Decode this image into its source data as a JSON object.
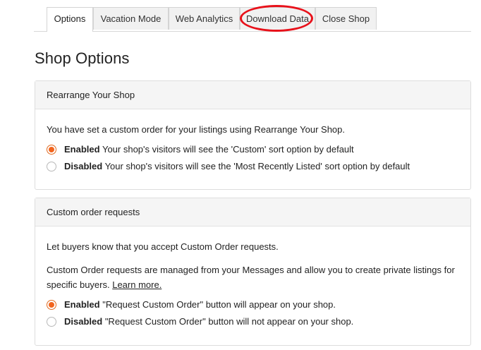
{
  "tabs": [
    {
      "label": "Options",
      "active": true
    },
    {
      "label": "Vacation Mode",
      "active": false
    },
    {
      "label": "Web Analytics",
      "active": false
    },
    {
      "label": "Download Data",
      "active": false
    },
    {
      "label": "Close Shop",
      "active": false
    }
  ],
  "highlight_color": "#e8111a",
  "accent_color": "#f1641e",
  "page_title": "Shop Options",
  "rearrange": {
    "header": "Rearrange Your Shop",
    "description": "You have set a custom order for your listings using Rearrange Your Shop.",
    "options": [
      {
        "label": "Enabled",
        "text": "Your shop's visitors will see the 'Custom' sort option by default",
        "checked": true
      },
      {
        "label": "Disabled",
        "text": "Your shop's visitors will see the 'Most Recently Listed' sort option by default",
        "checked": false
      }
    ]
  },
  "custom_orders": {
    "header": "Custom order requests",
    "description": "Let buyers know that you accept Custom Order requests.",
    "description2": "Custom Order requests are managed from your Messages and allow you to create private listings for specific buyers.",
    "learn_more": "Learn more.",
    "options": [
      {
        "label": "Enabled",
        "text": "\"Request Custom Order\" button will appear on your shop.",
        "checked": true
      },
      {
        "label": "Disabled",
        "text": "\"Request Custom Order\" button will not appear on your shop.",
        "checked": false
      }
    ]
  }
}
